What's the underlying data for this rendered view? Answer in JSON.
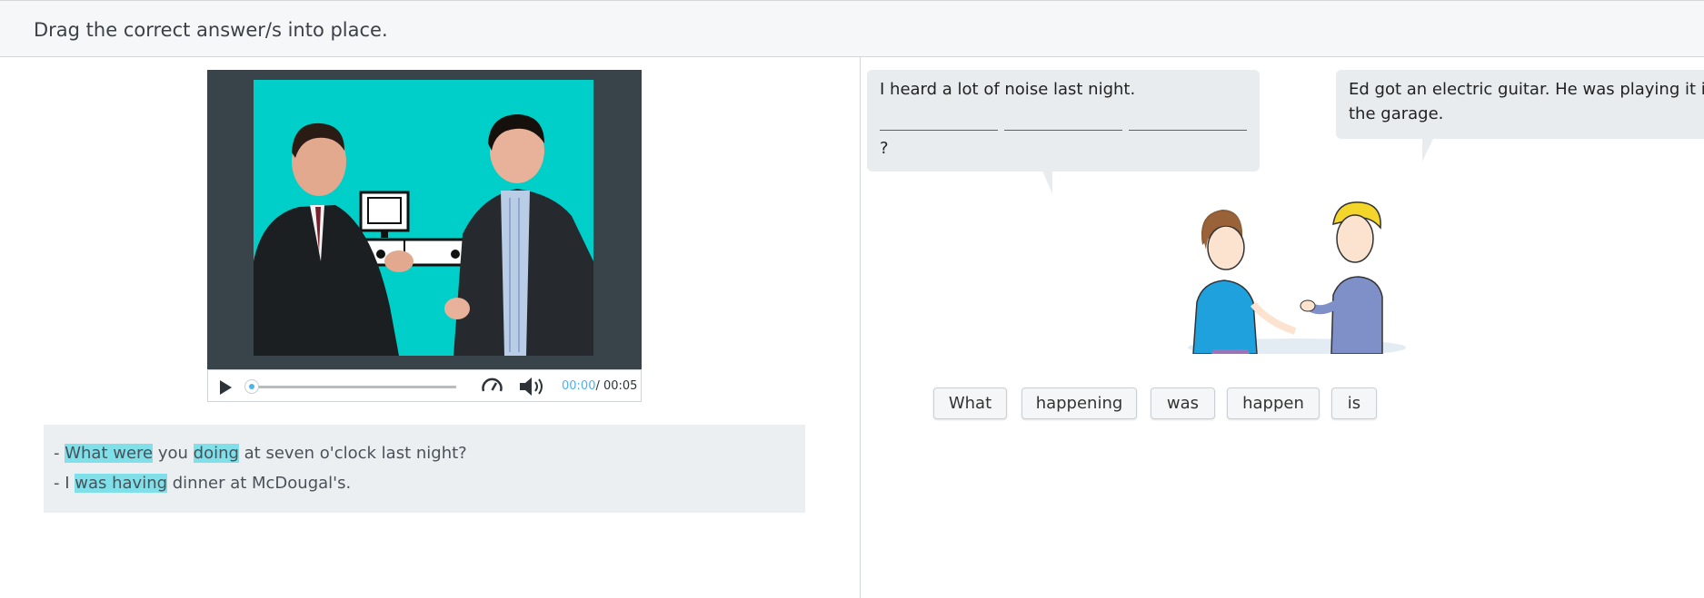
{
  "instruction": "Drag the correct answer/s into place.",
  "video": {
    "current_time": "00:00",
    "duration": "/ 00:05"
  },
  "transcript": {
    "line1": {
      "prefix": "- ",
      "hl1": "What were",
      "mid1": " you ",
      "hl2": "doing",
      "rest": " at seven o'clock last night?"
    },
    "line2": {
      "prefix": "- I ",
      "hl1": "was having",
      "rest": " dinner at McDougal's."
    }
  },
  "dialogue": {
    "bubble1": {
      "line1": "I heard a lot of noise last night.",
      "end": "?"
    },
    "bubble2": {
      "line1": "Ed got an electric guitar. He was playing it in",
      "line2": "the garage."
    }
  },
  "answer_options": [
    "What",
    "happening",
    "was",
    "happen",
    "is"
  ],
  "colors": {
    "accent": "#4fb2e8",
    "highlight": "#7fe0ea",
    "video_bg": "#00cec8"
  },
  "icons": [
    "play-icon",
    "speed-icon",
    "volume-icon"
  ]
}
